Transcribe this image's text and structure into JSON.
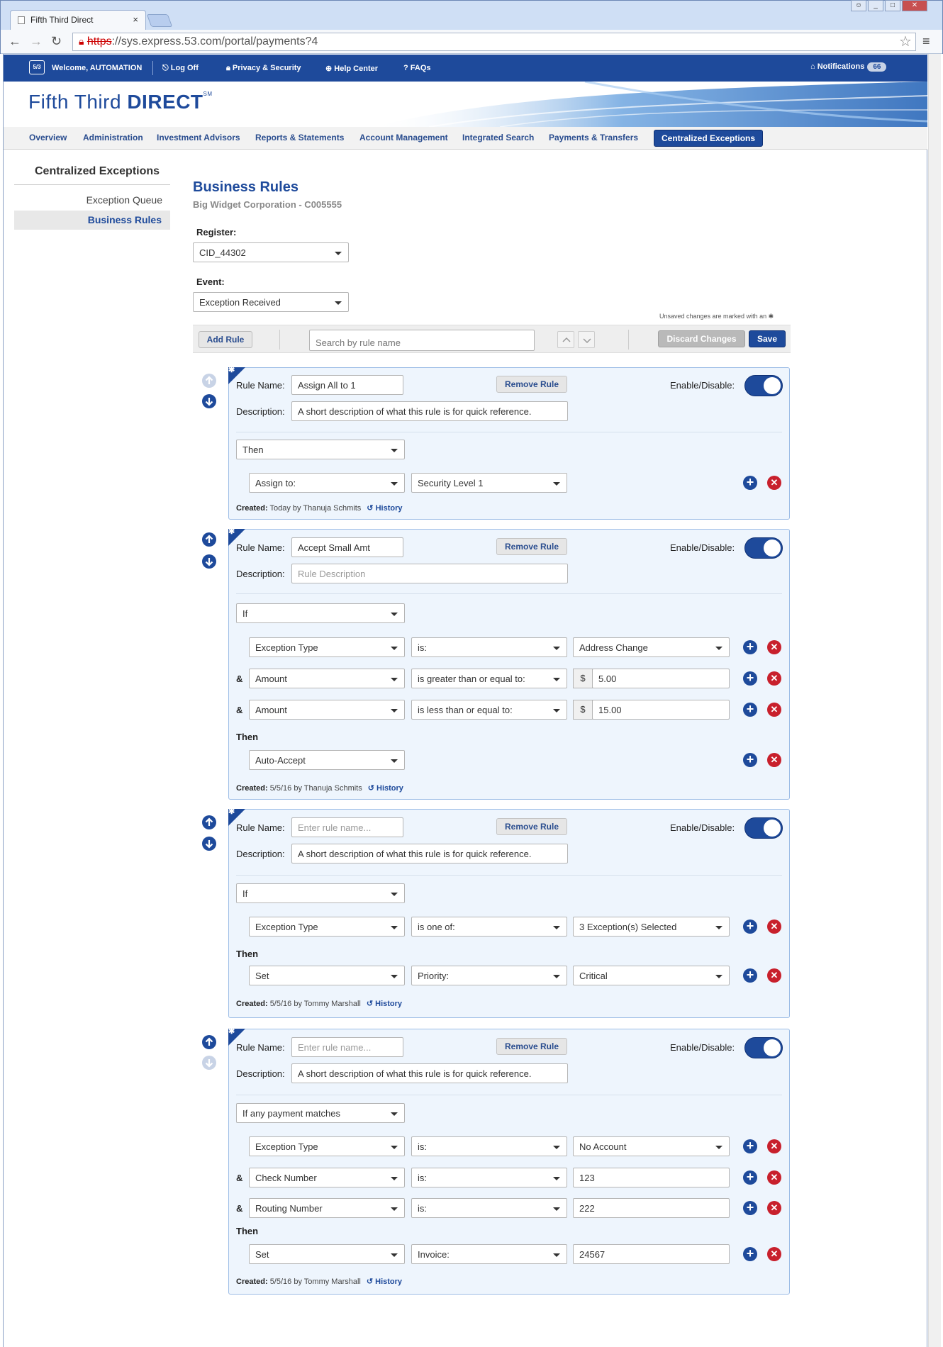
{
  "browser": {
    "tab_title": "Fifth Third Direct",
    "url_scheme": "https",
    "url_rest": "://sys.express.53.com/portal/payments?4"
  },
  "topnav": {
    "logo": "5/3",
    "welcome": "Welcome, AUTOMATION",
    "log_off": "Log Off",
    "privacy": "Privacy & Security",
    "help": "Help Center",
    "faqs": "FAQs",
    "notifications": "Notifications",
    "notifications_count": "66"
  },
  "brand": {
    "light": "Fifth Third ",
    "bold": "DIRECT",
    "mark": "SM"
  },
  "mainnav": [
    "Overview",
    "Administration",
    "Investment Advisors",
    "Reports & Statements",
    "Account Management",
    "Integrated Search",
    "Payments & Transfers",
    "Centralized Exceptions"
  ],
  "sidebar": {
    "title": "Centralized Exceptions",
    "items": [
      "Exception Queue",
      "Business Rules"
    ]
  },
  "page": {
    "title": "Business Rules",
    "subtitle": "Big Widget Corporation - C005555",
    "register_label": "Register:",
    "register_value": "CID_44302",
    "event_label": "Event:",
    "event_value": "Exception Received",
    "unsaved_note": "Unsaved changes are marked with an ✱"
  },
  "actionbar": {
    "add_rule": "Add Rule",
    "search_placeholder": "Search by rule name",
    "discard": "Discard Changes",
    "save": "Save"
  },
  "labels": {
    "rule_name": "Rule Name:",
    "description": "Description:",
    "remove_rule": "Remove Rule",
    "enable": "Enable/Disable:",
    "then": "Then",
    "and": "&",
    "created": "Created:",
    "history": "History",
    "dollar": "$"
  },
  "rules": [
    {
      "name": "Assign All to 1",
      "description": "A short description of what this rule is for quick reference.",
      "condition": "Then",
      "actions": [
        [
          "Assign to:",
          "Security Level 1"
        ]
      ],
      "created": "Today by Thanuja Schmits"
    },
    {
      "name": "Accept Small Amt",
      "description_placeholder": "Rule Description",
      "condition": "If",
      "criteria": [
        [
          "Exception Type",
          "is:",
          "Address Change"
        ],
        [
          "Amount",
          "is greater than or equal to:",
          "5.00"
        ],
        [
          "Amount",
          "is less than or equal to:",
          "15.00"
        ]
      ],
      "actions": [
        [
          "Auto-Accept"
        ]
      ],
      "created": "5/5/16 by Thanuja Schmits"
    },
    {
      "name_placeholder": "Enter rule name...",
      "description": "A short description of what this rule is for quick reference.",
      "condition": "If",
      "criteria": [
        [
          "Exception Type",
          "is one of:",
          "3 Exception(s) Selected"
        ]
      ],
      "actions": [
        [
          "Set",
          "Priority:",
          "Critical"
        ]
      ],
      "created": "5/5/16 by Tommy Marshall"
    },
    {
      "name_placeholder": "Enter rule name...",
      "description": "A short description of what this rule is for quick reference.",
      "condition": "If any payment matches",
      "criteria": [
        [
          "Exception Type",
          "is:",
          "No Account"
        ],
        [
          "Check Number",
          "is:",
          "123"
        ],
        [
          "Routing Number",
          "is:",
          "222"
        ]
      ],
      "actions": [
        [
          "Set",
          "Invoice:",
          "24567"
        ]
      ],
      "created": "5/5/16 by Tommy Marshall"
    }
  ],
  "colors": {
    "brand_blue": "#1e4a9b",
    "delete_red": "#c8202c",
    "card_bg": "#eef5fd"
  },
  "icons": [
    "lock-icon",
    "help-icon",
    "faq-icon",
    "bell-icon",
    "plus-icon",
    "delete-icon",
    "arrow-up-icon",
    "arrow-down-icon",
    "history-icon",
    "chevron-down-icon",
    "star-icon",
    "menu-icon"
  ]
}
